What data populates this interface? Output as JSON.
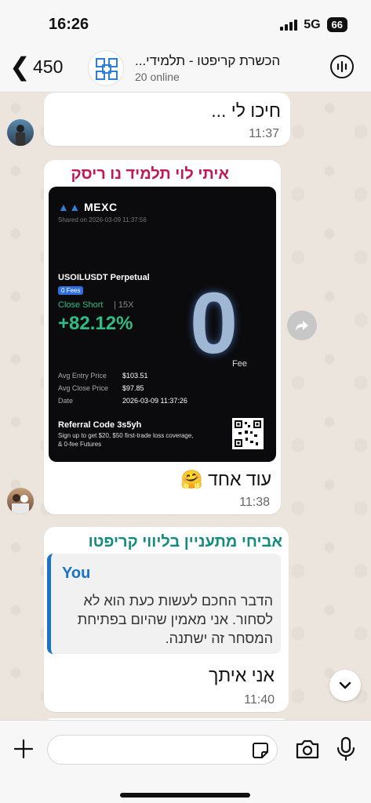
{
  "status_bar": {
    "time": "16:26",
    "network": "5G",
    "battery": "66"
  },
  "header": {
    "back_count": "450",
    "group_name": "הכשרת קריפטו - תלמידי...",
    "subtitle": "20 online"
  },
  "messages": [
    {
      "text": "חיכו לי ...",
      "time": "11:37"
    },
    {
      "sender": "איתי לוי תלמיד נו ריסק",
      "sender_color": "#c2185b",
      "card": {
        "brand": "MEXC",
        "shared_on": "Shared on 2026-03-09 11:37:56",
        "pair": "USOILUSDT Perpetual",
        "fee_badge": "0 Fees",
        "side": "Close Short",
        "leverage": "15X",
        "pnl": "+82.12%",
        "avg_entry_label": "Avg Entry Price",
        "avg_entry": "$103.51",
        "avg_close_label": "Avg Close Price",
        "avg_close": "$97.85",
        "date_label": "Date",
        "date": "2026-03-09 11:37:26",
        "referral": "Referral Code 3s5yh",
        "promo_line1": "Sign up to get $20, $50 first-trade loss coverage,",
        "promo_line2": "& 0-fee Futures",
        "fee_graphic": "0",
        "fee_word": "Fee"
      },
      "text": "עוד אחד 🤗",
      "time": "11:38"
    },
    {
      "sender": "אביחי מתעניין בליווי קריפטו",
      "sender_color": "#128c7e",
      "quote": {
        "author": "You",
        "line1": "הדבר החכם לעשות כעת הוא לא",
        "line2": "לסחור. אני מאמין שהיום בפתיחת",
        "line3": "המסחר זה ישתנה."
      },
      "text": "אני איתך",
      "time": "11:40"
    }
  ],
  "icons": [
    "back-chevron-icon",
    "voice-chat-icon",
    "forward-icon",
    "scroll-down-icon",
    "plus-icon",
    "sticker-icon",
    "camera-icon",
    "mic-icon"
  ]
}
